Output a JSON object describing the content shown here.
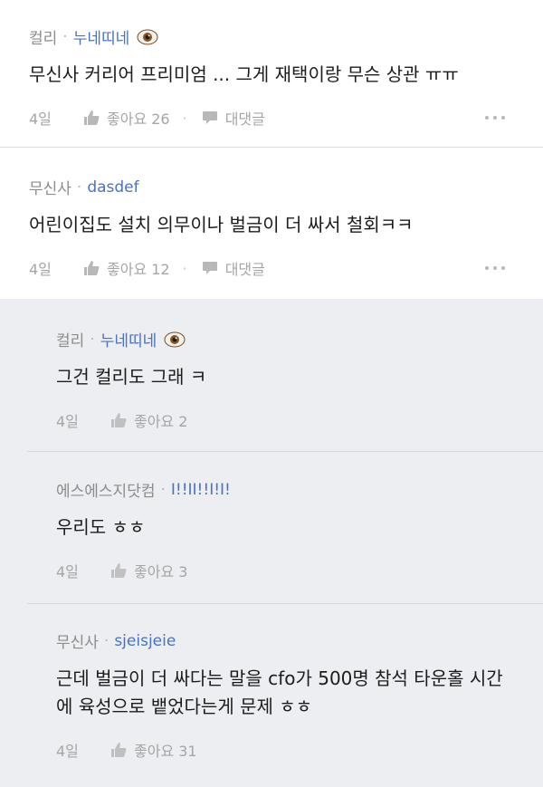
{
  "comments": [
    {
      "company": "컬리",
      "user": "누네띠네",
      "has_eye_emoji": true,
      "text": "무신사 커리어 프리미엄 ... 그게 재택이랑 무슨 상관 ㅠㅠ",
      "date": "4일",
      "like_label": "좋아요 26",
      "reply_label": "대댓글"
    },
    {
      "company": "무신사",
      "user": "dasdef",
      "has_eye_emoji": false,
      "text": "어린이집도 설치 의무이나 벌금이 더 싸서 철회ㅋㅋ",
      "date": "4일",
      "like_label": "좋아요 12",
      "reply_label": "대댓글"
    }
  ],
  "replies": [
    {
      "company": "컬리",
      "user": "누네띠네",
      "has_eye_emoji": true,
      "text": "그건 컬리도 그래 ㅋ",
      "date": "4일",
      "like_label": "좋아요 2"
    },
    {
      "company": "에스에스지닷컴",
      "user": "I!!II!!I!I!",
      "has_eye_emoji": false,
      "text": "우리도 ㅎㅎ",
      "date": "4일",
      "like_label": "좋아요 3"
    },
    {
      "company": "무신사",
      "user": "sjeisjeie",
      "has_eye_emoji": false,
      "text": "근데 벌금이 더 싸다는 말을 cfo가 500명 참석 타운홀 시간에 육성으로 뱉었다는게 문제 ㅎㅎ",
      "date": "4일",
      "like_label": "좋아요 31"
    }
  ],
  "meta_separator": "·",
  "like_separator": "·",
  "colors": {
    "user_link": "#4a72c4",
    "reply_bg": "#eceef2",
    "muted": "#a5a5a5"
  }
}
